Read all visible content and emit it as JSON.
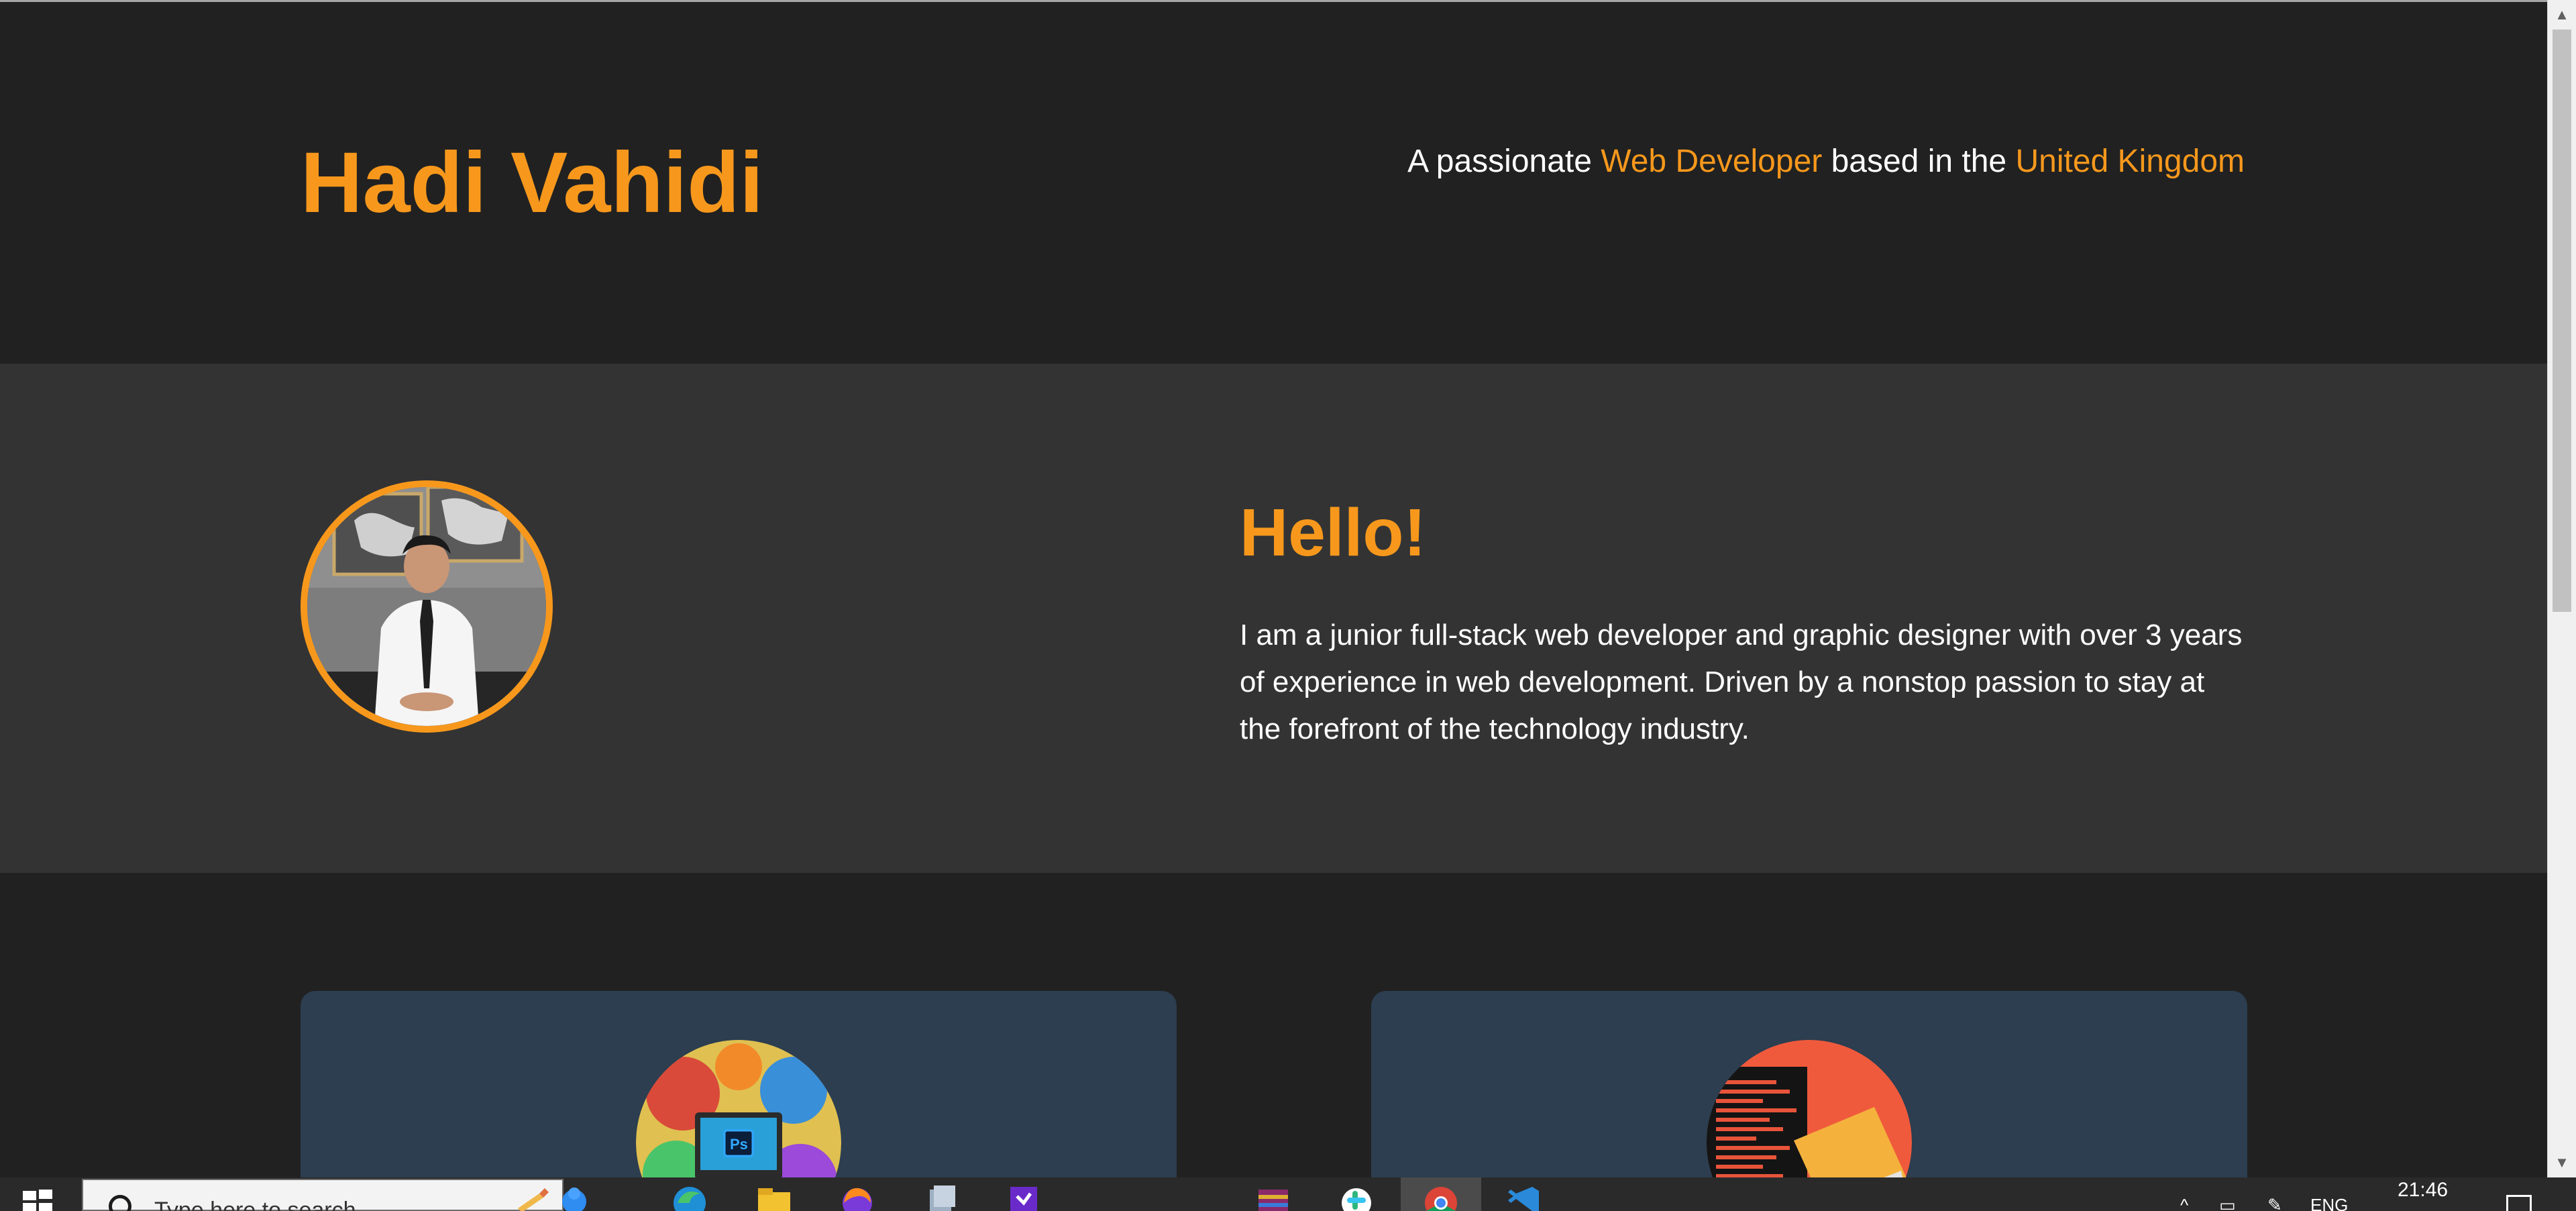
{
  "header": {
    "name": "Hadi Vahidi",
    "tagline_prefix": "A passionate ",
    "tagline_role": "Web Developer",
    "tagline_middle": " based in the ",
    "tagline_place": "United Kingdom"
  },
  "about": {
    "heading": "Hello!",
    "intro": "I am a junior full-stack web developer and graphic designer with over 3 years of experience in web development. Driven by a nonstop passion to stay at the forefront of the technology industry."
  },
  "skills": {
    "cards": [
      {
        "icon": "graphic-design-illustration-icon"
      },
      {
        "icon": "laptop-code-illustration-icon"
      }
    ]
  },
  "taskbar": {
    "search_placeholder": "Type here to search",
    "apps": [
      "edge-icon",
      "file-explorer-icon",
      "firefox-icon",
      "files-icon",
      "visual-studio-icon",
      "winrar-icon",
      "slack-icon",
      "chrome-icon",
      "vscode-icon"
    ],
    "language": "ENG",
    "time": "21:46"
  },
  "colors": {
    "accent": "#f7981c",
    "header_bg": "#212121",
    "about_bg": "#333333",
    "card_bg": "#2c3e50"
  }
}
